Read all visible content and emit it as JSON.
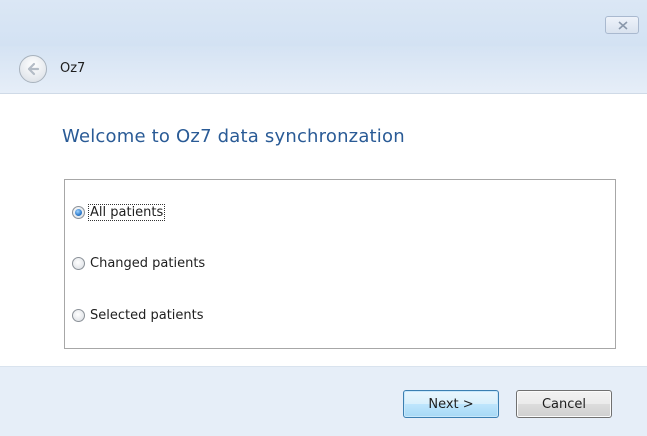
{
  "window": {
    "nav_title": "Oz7"
  },
  "page": {
    "heading": "Welcome to Oz7 data synchronzation"
  },
  "options": [
    {
      "label": "All patients",
      "selected": true
    },
    {
      "label": "Changed patients",
      "selected": false
    },
    {
      "label": "Selected patients",
      "selected": false
    }
  ],
  "footer": {
    "next_label": "Next >",
    "cancel_label": "Cancel"
  },
  "colors": {
    "heading": "#2a5b96",
    "footer_bg": "#e6eef8",
    "titlebar_bg": "#d3e2f3"
  },
  "icons": {
    "close": "close-icon",
    "back": "back-arrow-icon"
  }
}
